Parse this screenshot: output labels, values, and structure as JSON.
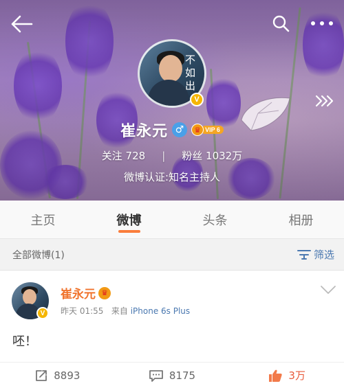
{
  "profile": {
    "name": "崔永元",
    "vip_label": "VIP 6",
    "following_label": "关注",
    "following_count": "728",
    "followers_label": "粉丝",
    "followers_count": "1032万",
    "verification": "微博认证:知名主持人",
    "avatar_calligraphy": "不\n如\n出"
  },
  "tabs": [
    {
      "label": "主页"
    },
    {
      "label": "微博"
    },
    {
      "label": "头条"
    },
    {
      "label": "相册"
    }
  ],
  "active_tab": "微博",
  "filter": {
    "title": "全部微博(1)",
    "button_label": "筛选"
  },
  "post": {
    "author": "崔永元",
    "time": "昨天 01:55",
    "source_prefix": "来自",
    "source": "iPhone 6s Plus",
    "text": "呸！",
    "reposts": "8893",
    "comments": "8175",
    "likes": "3万"
  },
  "colors": {
    "accent": "#fa7d3c",
    "author_name": "#f0732c",
    "link": "#4a78b0",
    "verified_badge": "#f5b600"
  },
  "icons": {
    "back": "arrow-left-icon",
    "search": "search-icon",
    "more": "more-dots-icon",
    "expand": "triple-chevron-right-icon",
    "gender": "male-icon",
    "filter": "filter-icon",
    "repost": "repost-icon",
    "comment": "comment-icon",
    "like": "thumbs-up-icon"
  }
}
